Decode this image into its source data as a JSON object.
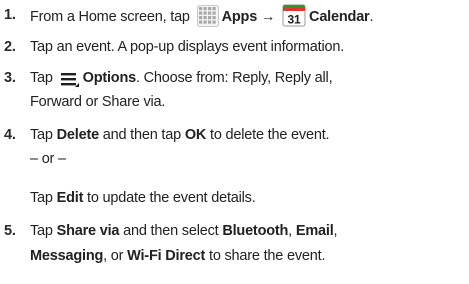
{
  "steps": [
    {
      "number": "1.",
      "lines": [
        {
          "parts": [
            {
              "text": "From a Home screen, tap ",
              "bold": false
            },
            {
              "icon": "apps-grid-icon"
            },
            {
              "text": "Apps",
              "bold": true
            },
            {
              "text": " → ",
              "bold": true
            },
            {
              "icon": "calendar-icon",
              "calendar_day": "31"
            },
            {
              "text": "Calendar",
              "bold": true
            },
            {
              "text": ".",
              "bold": false
            }
          ]
        }
      ]
    },
    {
      "number": "2.",
      "lines": [
        {
          "parts": [
            {
              "text": "Tap an event. A pop-up displays event information.",
              "bold": false
            }
          ]
        }
      ]
    },
    {
      "number": "3.",
      "lines": [
        {
          "parts": [
            {
              "text": "Tap ",
              "bold": false
            },
            {
              "icon": "options-menu-icon"
            },
            {
              "text": "Options",
              "bold": true
            },
            {
              "text": ". Choose from: Reply, Reply all,",
              "bold": false
            }
          ]
        },
        {
          "parts": [
            {
              "text": "Forward or Share via.",
              "bold": false
            }
          ]
        }
      ]
    },
    {
      "number": "4.",
      "lines": [
        {
          "parts": [
            {
              "text": "Tap ",
              "bold": false
            },
            {
              "text": "Delete",
              "bold": true
            },
            {
              "text": " and then tap ",
              "bold": false
            },
            {
              "text": "OK",
              "bold": true
            },
            {
              "text": " to delete the event.",
              "bold": false
            }
          ]
        },
        {
          "parts": [
            {
              "text": "– or –",
              "bold": false
            }
          ]
        },
        {
          "gap_before": true,
          "parts": [
            {
              "text": "Tap ",
              "bold": false
            },
            {
              "text": "Edit",
              "bold": true
            },
            {
              "text": " to update the event details.",
              "bold": false
            }
          ]
        }
      ]
    },
    {
      "number": "5.",
      "lines": [
        {
          "parts": [
            {
              "text": "Tap ",
              "bold": false
            },
            {
              "text": "Share via",
              "bold": true
            },
            {
              "text": " and then select ",
              "bold": false
            },
            {
              "text": "Bluetooth",
              "bold": true
            },
            {
              "text": ", ",
              "bold": false
            },
            {
              "text": "Email",
              "bold": true
            },
            {
              "text": ",",
              "bold": false
            }
          ]
        },
        {
          "parts": [
            {
              "text": "Messaging",
              "bold": true
            },
            {
              "text": ", or ",
              "bold": false
            },
            {
              "text": "Wi-Fi Direct",
              "bold": true
            },
            {
              "text": " to share the event.",
              "bold": false
            }
          ]
        }
      ]
    }
  ],
  "colors": {
    "text": "#222222",
    "calendar_red": "#d83a2c",
    "calendar_green": "#3a8f2e",
    "apps_grid": "#a8a8a8",
    "options_icon": "#1f1f1f"
  }
}
